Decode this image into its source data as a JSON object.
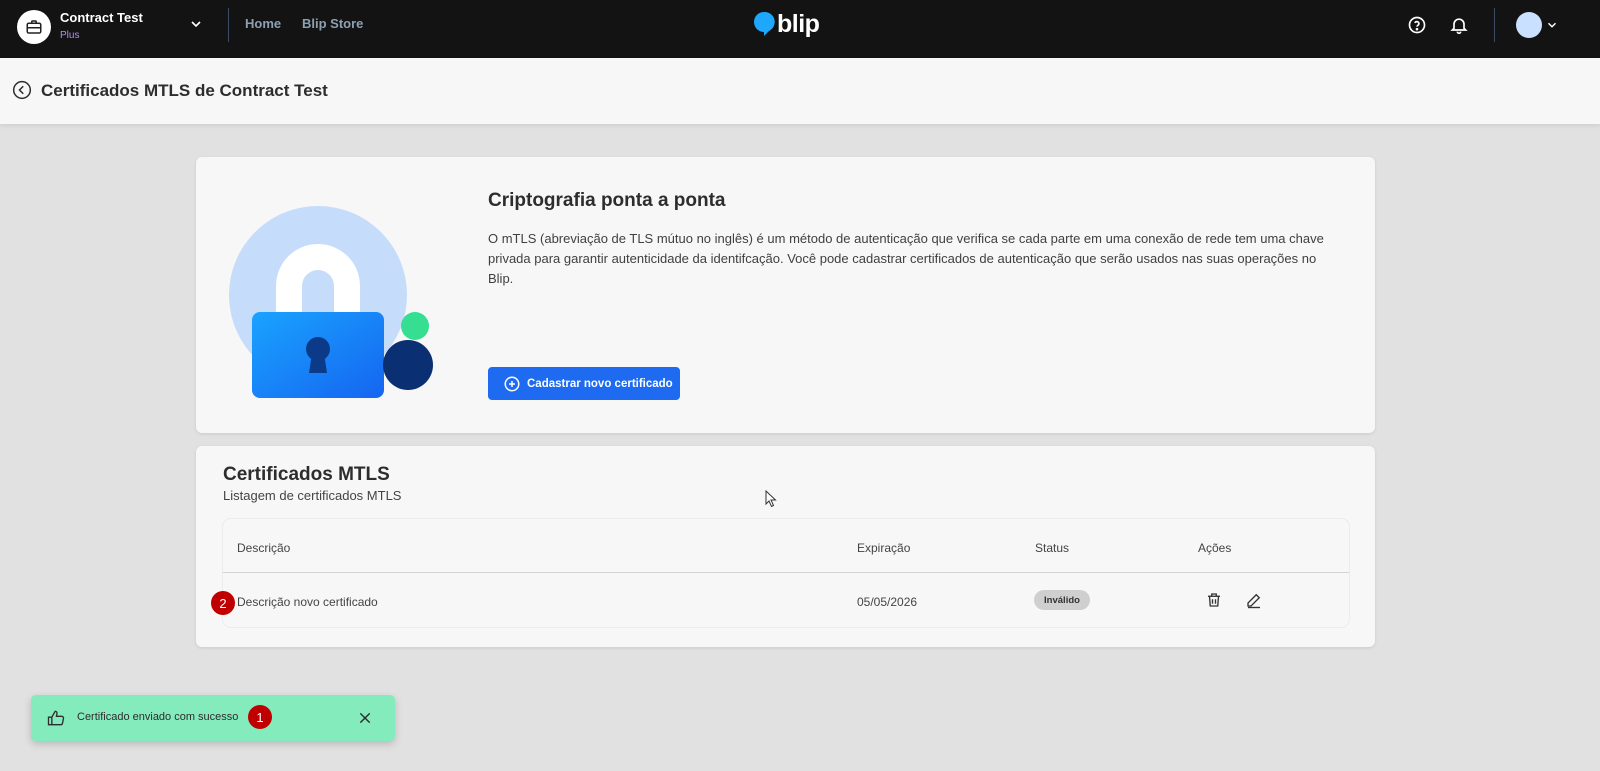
{
  "topbar": {
    "tenant_name": "Contract Test",
    "tenant_plan": "Plus",
    "nav_links": [
      "Home",
      "Blip Store"
    ],
    "logo_text": "blip",
    "icons": [
      "briefcase-icon",
      "chevron-down-icon",
      "help-icon",
      "bell-icon",
      "avatar",
      "chevron-down-icon"
    ]
  },
  "header": {
    "title": "Certificados MTLS de Contract Test"
  },
  "info_card": {
    "title": "Criptografia ponta a ponta",
    "description": "O mTLS (abreviação de TLS mútuo no inglês) é um método de autenticação que verifica se cada parte em uma conexão de rede tem uma chave privada para garantir autenticidade da identifcação. Você pode cadastrar certificados de autenticação que serão usados nas suas operações no Blip.",
    "button_label": "Cadastrar novo certificado"
  },
  "list_card": {
    "title": "Certificados MTLS",
    "subtitle": "Listagem de certificados MTLS",
    "columns": [
      "Descrição",
      "Expiração",
      "Status",
      "Ações"
    ],
    "rows": [
      {
        "description": "Descrição novo certificado",
        "expiration": "05/05/2026",
        "status": "Inválido"
      }
    ]
  },
  "toast": {
    "message": "Certificado enviado com sucesso"
  },
  "markers": [
    "1",
    "2"
  ],
  "colors": {
    "topbar_bg": "#131313",
    "primary": "#1e6bf1",
    "toast_bg": "#84ebbc",
    "marker": "#c00000",
    "plan_label": "#b18cf7"
  }
}
